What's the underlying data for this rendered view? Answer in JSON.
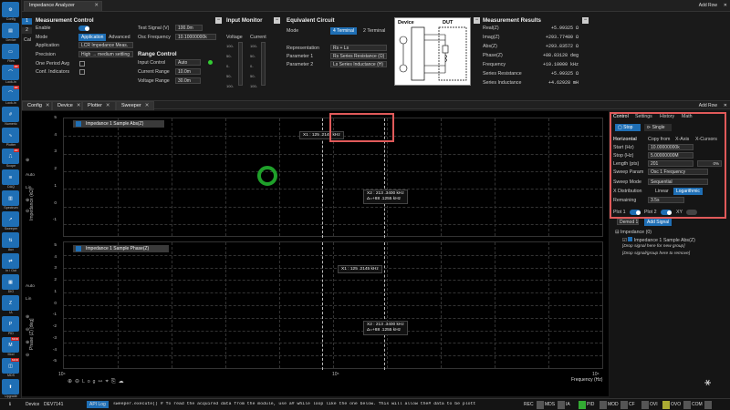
{
  "app": {
    "title": "Impedance Analyzer",
    "add_row": "Add Row",
    "add_row_bottom": "Add Row"
  },
  "left_sidebar": {
    "items": [
      {
        "label": "Config",
        "icon": "gear-icon",
        "badge": ""
      },
      {
        "label": "Device",
        "icon": "chip-icon",
        "badge": ""
      },
      {
        "label": "Files",
        "icon": "folder-icon",
        "badge": ""
      },
      {
        "label": "Lock-in",
        "icon": "lockin-icon",
        "badge": "MF"
      },
      {
        "label": "Lock-in",
        "icon": "lockin-icon",
        "badge": "MF"
      },
      {
        "label": "Numeric",
        "icon": "numeric-icon",
        "badge": ""
      },
      {
        "label": "Plotter",
        "icon": "plotter-icon",
        "badge": ""
      },
      {
        "label": "Scope",
        "icon": "scope-icon",
        "badge": "MF"
      },
      {
        "label": "DAQ",
        "icon": "daq-icon",
        "badge": ""
      },
      {
        "label": "Spectrum",
        "icon": "spectrum-icon",
        "badge": ""
      },
      {
        "label": "Sweeper",
        "icon": "sweeper-icon",
        "badge": ""
      },
      {
        "label": "Aux",
        "icon": "aux-icon",
        "badge": ""
      },
      {
        "label": "In / Out",
        "icon": "inout-icon",
        "badge": ""
      },
      {
        "label": "DIO",
        "icon": "dio-icon",
        "badge": ""
      },
      {
        "label": "IA",
        "icon": "ia-icon",
        "badge": ""
      },
      {
        "label": "PID",
        "icon": "pid-icon",
        "badge": ""
      },
      {
        "label": "Mod",
        "icon": "mod-icon",
        "badge": "MOD"
      },
      {
        "label": "MDS",
        "icon": "mds-icon",
        "badge": "MOD"
      },
      {
        "label": "Upgrade",
        "icon": "upgrade-icon",
        "badge": ""
      }
    ]
  },
  "top_tabs": [
    {
      "label": "Impedance Analyzer",
      "closable": true
    }
  ],
  "measurement_control": {
    "title": "Measurement Control",
    "channel_numbers": [
      "1",
      "2"
    ],
    "cal_label": "Cal",
    "enable_label": "Enable",
    "mode_label": "Mode",
    "mode_options": [
      "Application",
      "Advanced"
    ],
    "mode_selected": "Application",
    "application_label": "Application",
    "application_value": "LCR Impedance Meas.",
    "precision_label": "Precision",
    "precision_value": "High → medium settling",
    "one_period_label": "One Period Avg",
    "conf_ind_label": "Conf. Indicators",
    "test_signal_label": "Test Signal (V)",
    "test_signal_value": "100.0m",
    "osc_freq_label": "Osc Frequency",
    "osc_freq_value": "10.10000000k",
    "range_control_title": "Range Control",
    "input_control_label": "Input Control",
    "input_control_value": "Auto",
    "current_range_label": "Current Range",
    "current_range_value": "10.0m",
    "voltage_range_label": "Voltage Range",
    "voltage_range_value": "30.0m"
  },
  "input_monitor": {
    "title": "Input Monitor",
    "voltage_label": "Voltage",
    "current_label": "Current",
    "ticks": [
      "100-",
      "50-",
      "0-",
      "50-",
      "100-"
    ]
  },
  "equivalent_circuit": {
    "title": "Equivalent Circuit",
    "mode_label": "Mode",
    "mode_options": [
      "4 Terminal",
      "2 Terminal"
    ],
    "mode_selected": "4 Terminal",
    "representation_label": "Representation",
    "representation_value": "Rs + Ls",
    "param1_label": "Parameter 1",
    "param1_value": "Rs Series Resistance (Ω)",
    "param2_label": "Parameter 2",
    "param2_value": "Ls Series Inductance (H)",
    "device_label": "Device",
    "dut_label": "DUT"
  },
  "measurement_results": {
    "title": "Measurement Results",
    "rows": [
      {
        "label": "Real(Z)",
        "value": "+5.99325 Ω"
      },
      {
        "label": "Imag(Z)",
        "value": "+293.77480 Ω"
      },
      {
        "label": "Abs(Z)",
        "value": "+293.83572 Ω"
      },
      {
        "label": "Phase(Z)",
        "value": "+88.83128 deg"
      },
      {
        "label": "Frequency",
        "value": "+10.10000 kHz"
      },
      {
        "label": "Series Resistance",
        "value": "+5.99325 Ω"
      },
      {
        "label": "Series Inductance",
        "value": "+4.62928 mH"
      }
    ]
  },
  "bottom_tabs": [
    {
      "label": "Config"
    },
    {
      "label": "Device"
    },
    {
      "label": "Plotter"
    },
    {
      "label": "Sweeper",
      "active": true
    }
  ],
  "plot_top": {
    "legend": "Impedance 1 Sample Abs(Z)",
    "ylabel": "Impedance (kΩ)",
    "yticks": [
      "5",
      "4",
      "3",
      "2",
      "1",
      "0",
      "-1"
    ],
    "cursor_x1": "X1 : 125 .2145 kHz",
    "cursor_x2": "X2 : 213 .3400 kHz",
    "cursor_delta": "Δ=+88 .1255 kHz"
  },
  "plot_bottom": {
    "legend": "Impedance 1 Sample Phase(Z)",
    "ylabel": "Phase (Z) [deg]",
    "yticks": [
      "5",
      "4",
      "3",
      "2",
      "1",
      "0",
      "-1",
      "-2",
      "-3",
      "-4",
      "-5"
    ],
    "cursor_x1": "X1 : 125 .2145 kHz",
    "cursor_x2": "X2 : 213 .3400 kHz",
    "cursor_delta": "Δ=+88 .1255 kHz"
  },
  "x_axis": {
    "label": "Frequency (Hz)",
    "ticks": [
      "10⁴",
      "10⁵",
      "10⁶"
    ]
  },
  "plot_side_controls": {
    "auto": "Auto",
    "lin": "Lin",
    "log": "Log",
    "auto2": "Auto",
    "lin2": "Lin"
  },
  "sweeper_panel": {
    "tabs": [
      "Control",
      "Settings",
      "History",
      "Math"
    ],
    "active_tab": "Control",
    "stop_label": "Stop",
    "single_label": "Single",
    "horizontal_label": "Horizontal",
    "copy_from_label": "Copy from",
    "x_axis_label": "X-Axis",
    "x_cursors_label": "X-Cursors",
    "start_label": "Start (Hz)",
    "start_value": "10.00000000k",
    "stop_hz_label": "Stop (Hz)",
    "stop_hz_value": "5.00000000M",
    "length_label": "Length (pts)",
    "length_value": "201",
    "progress": "0%",
    "sweep_param_label": "Sweep Param",
    "sweep_param_value": "Osc 1 Frequency",
    "sweep_mode_label": "Sweep Mode",
    "sweep_mode_value": "Sequential",
    "xdist_label": "X Distribution",
    "xdist_options": [
      "Linear",
      "Logarithmic"
    ],
    "xdist_selected": "Logarithmic",
    "remaining_label": "Remaining",
    "remaining_value": "3.5s",
    "plot1_label": "Plot 1",
    "plot2_label": "Plot 2",
    "xy_label": "XY",
    "demod_label": "Demod 1",
    "add_signal_label": "Add Signal",
    "tree": {
      "group": "Impedance (0)",
      "item": "Impedance 1 Sample Abs(Z)",
      "drop1": "[Drop signal here for new group]",
      "drop2": "[Drop signal/group here to remove]"
    }
  },
  "status": {
    "device_label": "Device",
    "device_value": "DEV7141",
    "api_log": "API Log",
    "message": "sweeper.execute() # To read the acquired data from the module, use a# while loop like the one below. This will allow the# data to be plott",
    "leds": [
      "REC",
      "MDS",
      "IA",
      "PID",
      "MOD",
      "CF",
      "OVI",
      "OVO",
      "COM"
    ]
  }
}
